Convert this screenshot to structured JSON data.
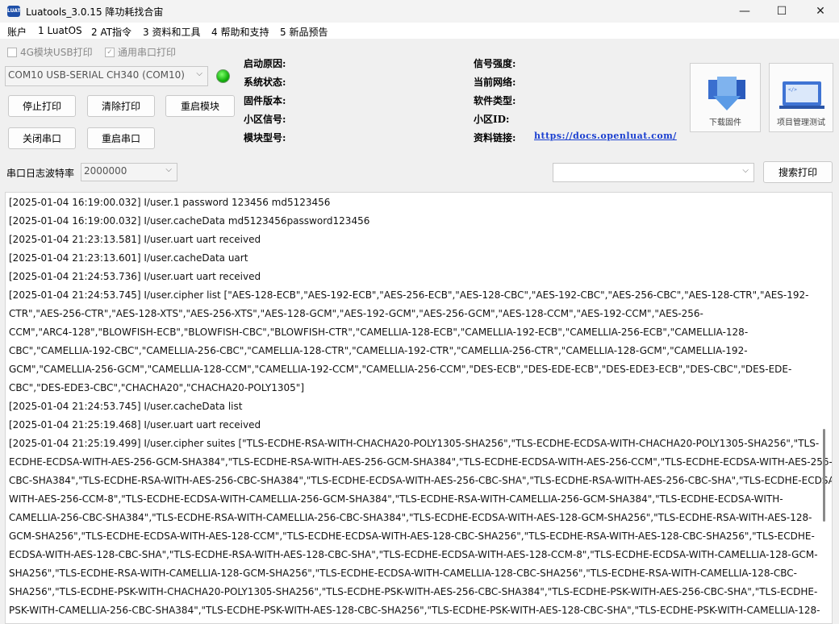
{
  "window": {
    "title": "Luatools_3.0.15 降功耗找合宙",
    "icon_text": "LUAT",
    "controls": {
      "minimize": "—",
      "maximize": "☐",
      "close": "✕"
    }
  },
  "menu": [
    "账户",
    "1 LuatOS",
    "2 AT指令",
    "3 资料和工具",
    "4 帮助和支持",
    "5 新品预告"
  ],
  "checkboxes": {
    "usb_print": {
      "label": "4G模块USB打印",
      "checked": false
    },
    "serial_print": {
      "label": "通用串口打印",
      "checked": true
    }
  },
  "port": {
    "value": "COM10 USB-SERIAL CH340 (COM10)",
    "status_color": "#13b00c"
  },
  "buttons": {
    "stop_print": "停止打印",
    "clear_print": "清除打印",
    "restart_module": "重启模块",
    "close_port": "关闭串口",
    "restart_port": "重启串口",
    "search_print": "搜索打印"
  },
  "device_info": {
    "boot_reason": "启动原因:",
    "system_status": "系统状态:",
    "firmware_version": "固件版本:",
    "cell_signal": "小区信号:",
    "module_model": "模块型号:",
    "signal_strength": "信号强度:",
    "current_network": "当前网络:",
    "software_type": "软件类型:",
    "cell_id": "小区ID:",
    "doc_link_label": "资料链接:",
    "doc_link": "https://docs.openluat.com/"
  },
  "tiles": {
    "download_firmware": "下载固件",
    "project_manager": "项目管理测试"
  },
  "baud": {
    "label": "串口日志波特率",
    "value": "2000000"
  },
  "search": {
    "value": ""
  },
  "log": [
    "[2025-01-04 16:19:00.032] I/user.1 password        123456  md5123456",
    "[2025-01-04 16:19:00.032] I/user.cacheData        md5123456password123456",
    "[2025-01-04 21:23:13.581] I/user.uart       uart received",
    "[2025-01-04 21:23:13.601] I/user.cacheData        uart",
    "[2025-01-04 21:24:53.736] I/user.uart       uart received",
    "[2025-01-04 21:24:53.745] I/user.cipher    list      [\"AES-128-ECB\",\"AES-192-ECB\",\"AES-256-ECB\",\"AES-128-CBC\",\"AES-192-CBC\",\"AES-256-CBC\",\"AES-128-CTR\",\"AES-192-",
    "CTR\",\"AES-256-CTR\",\"AES-128-XTS\",\"AES-256-XTS\",\"AES-128-GCM\",\"AES-192-GCM\",\"AES-256-GCM\",\"AES-128-CCM\",\"AES-192-CCM\",\"AES-256-",
    "CCM\",\"ARC4-128\",\"BLOWFISH-ECB\",\"BLOWFISH-CBC\",\"BLOWFISH-CTR\",\"CAMELLIA-128-ECB\",\"CAMELLIA-192-ECB\",\"CAMELLIA-256-ECB\",\"CAMELLIA-128-",
    "CBC\",\"CAMELLIA-192-CBC\",\"CAMELLIA-256-CBC\",\"CAMELLIA-128-CTR\",\"CAMELLIA-192-CTR\",\"CAMELLIA-256-CTR\",\"CAMELLIA-128-GCM\",\"CAMELLIA-192-",
    "GCM\",\"CAMELLIA-256-GCM\",\"CAMELLIA-128-CCM\",\"CAMELLIA-192-CCM\",\"CAMELLIA-256-CCM\",\"DES-ECB\",\"DES-EDE-ECB\",\"DES-EDE3-ECB\",\"DES-CBC\",\"DES-EDE-",
    "CBC\",\"DES-EDE3-CBC\",\"CHACHA20\",\"CHACHA20-POLY1305\"]",
    "[2025-01-04 21:24:53.745] I/user.cacheData        list",
    "[2025-01-04 21:25:19.468] I/user.uart       uart received",
    "[2025-01-04 21:25:19.499] I/user.cipher    suites    [\"TLS-ECDHE-RSA-WITH-CHACHA20-POLY1305-SHA256\",\"TLS-ECDHE-ECDSA-WITH-CHACHA20-POLY1305-SHA256\",\"TLS-",
    "ECDHE-ECDSA-WITH-AES-256-GCM-SHA384\",\"TLS-ECDHE-RSA-WITH-AES-256-GCM-SHA384\",\"TLS-ECDHE-ECDSA-WITH-AES-256-CCM\",\"TLS-ECDHE-ECDSA-WITH-AES-256-",
    "CBC-SHA384\",\"TLS-ECDHE-RSA-WITH-AES-256-CBC-SHA384\",\"TLS-ECDHE-ECDSA-WITH-AES-256-CBC-SHA\",\"TLS-ECDHE-RSA-WITH-AES-256-CBC-SHA\",\"TLS-ECDHE-ECDSA-",
    "WITH-AES-256-CCM-8\",\"TLS-ECDHE-ECDSA-WITH-CAMELLIA-256-GCM-SHA384\",\"TLS-ECDHE-RSA-WITH-CAMELLIA-256-GCM-SHA384\",\"TLS-ECDHE-ECDSA-WITH-",
    "CAMELLIA-256-CBC-SHA384\",\"TLS-ECDHE-RSA-WITH-CAMELLIA-256-CBC-SHA384\",\"TLS-ECDHE-ECDSA-WITH-AES-128-GCM-SHA256\",\"TLS-ECDHE-RSA-WITH-AES-128-",
    "GCM-SHA256\",\"TLS-ECDHE-ECDSA-WITH-AES-128-CCM\",\"TLS-ECDHE-ECDSA-WITH-AES-128-CBC-SHA256\",\"TLS-ECDHE-RSA-WITH-AES-128-CBC-SHA256\",\"TLS-ECDHE-",
    "ECDSA-WITH-AES-128-CBC-SHA\",\"TLS-ECDHE-RSA-WITH-AES-128-CBC-SHA\",\"TLS-ECDHE-ECDSA-WITH-AES-128-CCM-8\",\"TLS-ECDHE-ECDSA-WITH-CAMELLIA-128-GCM-",
    "SHA256\",\"TLS-ECDHE-RSA-WITH-CAMELLIA-128-GCM-SHA256\",\"TLS-ECDHE-ECDSA-WITH-CAMELLIA-128-CBC-SHA256\",\"TLS-ECDHE-RSA-WITH-CAMELLIA-128-CBC-",
    "SHA256\",\"TLS-ECDHE-PSK-WITH-CHACHA20-POLY1305-SHA256\",\"TLS-ECDHE-PSK-WITH-AES-256-CBC-SHA384\",\"TLS-ECDHE-PSK-WITH-AES-256-CBC-SHA\",\"TLS-ECDHE-",
    "PSK-WITH-CAMELLIA-256-CBC-SHA384\",\"TLS-ECDHE-PSK-WITH-AES-128-CBC-SHA256\",\"TLS-ECDHE-PSK-WITH-AES-128-CBC-SHA\",\"TLS-ECDHE-PSK-WITH-CAMELLIA-128-"
  ]
}
